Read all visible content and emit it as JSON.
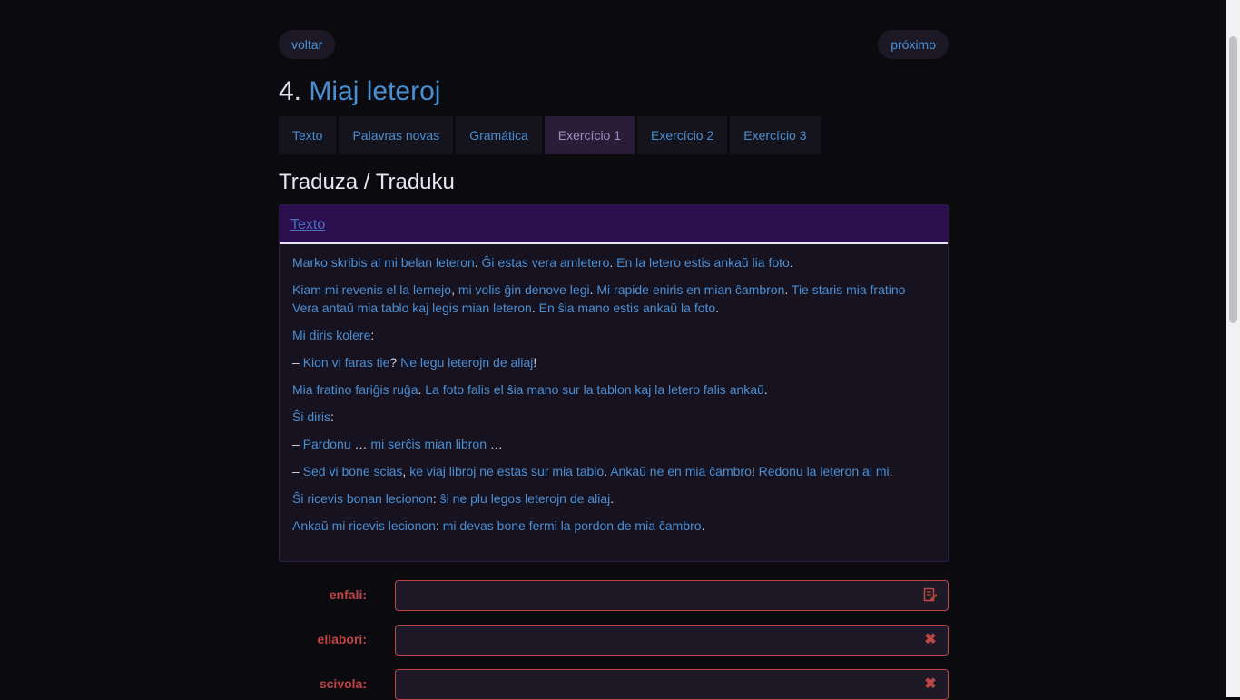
{
  "nav": {
    "back_label": "voltar",
    "next_label": "próximo"
  },
  "lesson": {
    "number": "4.",
    "name": "Miaj leteroj"
  },
  "tabs": [
    {
      "label": "Texto",
      "active": false
    },
    {
      "label": "Palavras novas",
      "active": false
    },
    {
      "label": "Gramática",
      "active": false
    },
    {
      "label": "Exercício 1",
      "active": true
    },
    {
      "label": "Exercício 2",
      "active": false
    },
    {
      "label": "Exercício 3",
      "active": false
    }
  ],
  "section_title": "Traduza / Traduku",
  "panel": {
    "header_link": "Texto",
    "paragraphs": [
      [
        {
          "t": "Marko skribis al mi belan leteron",
          "w": true
        },
        {
          "t": ". ",
          "w": false
        },
        {
          "t": "Ĝi estas vera amletero",
          "w": true
        },
        {
          "t": ". ",
          "w": false
        },
        {
          "t": "En la letero estis ankaŭ lia foto",
          "w": true
        },
        {
          "t": ".",
          "w": false
        }
      ],
      [
        {
          "t": "Kiam mi revenis el la lernejo",
          "w": true
        },
        {
          "t": ", ",
          "w": false
        },
        {
          "t": "mi volis ĝin denove legi",
          "w": true
        },
        {
          "t": ". ",
          "w": false
        },
        {
          "t": "Mi rapide eniris en mian ĉambron",
          "w": true
        },
        {
          "t": ". ",
          "w": false
        },
        {
          "t": "Tie staris mia fratino Vera antaŭ mia tablo kaj legis mian leteron",
          "w": true
        },
        {
          "t": ". ",
          "w": false
        },
        {
          "t": "En ŝia mano estis ankaŭ la foto",
          "w": true
        },
        {
          "t": ".",
          "w": false
        }
      ],
      [
        {
          "t": "Mi diris kolere",
          "w": true
        },
        {
          "t": ":",
          "w": false
        }
      ],
      [
        {
          "t": "– ",
          "w": false
        },
        {
          "t": "Kion vi faras tie",
          "w": true
        },
        {
          "t": "? ",
          "w": false
        },
        {
          "t": "Ne legu leterojn de aliaj",
          "w": true
        },
        {
          "t": "!",
          "w": false
        }
      ],
      [
        {
          "t": "Mia fratino fariĝis ruĝa",
          "w": true
        },
        {
          "t": ". ",
          "w": false
        },
        {
          "t": "La foto falis el ŝia mano sur la tablon kaj la letero falis ankaŭ",
          "w": true
        },
        {
          "t": ".",
          "w": false
        }
      ],
      [
        {
          "t": "Ŝi diris",
          "w": true
        },
        {
          "t": ":",
          "w": false
        }
      ],
      [
        {
          "t": "– ",
          "w": false
        },
        {
          "t": "Pardonu",
          "w": true
        },
        {
          "t": " … ",
          "w": false
        },
        {
          "t": "mi serĉis mian libron",
          "w": true
        },
        {
          "t": " …",
          "w": false
        }
      ],
      [
        {
          "t": "– ",
          "w": false
        },
        {
          "t": "Sed vi bone scias",
          "w": true
        },
        {
          "t": ", ",
          "w": false
        },
        {
          "t": "ke viaj libroj ne estas sur mia tablo",
          "w": true
        },
        {
          "t": ". ",
          "w": false
        },
        {
          "t": "Ankaŭ ne en mia ĉambro",
          "w": true
        },
        {
          "t": "! ",
          "w": false
        },
        {
          "t": "Redonu la leteron al mi",
          "w": true
        },
        {
          "t": ".",
          "w": false
        }
      ],
      [
        {
          "t": "Ŝi ricevis bonan lecionon",
          "w": true
        },
        {
          "t": ": ",
          "w": false
        },
        {
          "t": "ŝi ne plu legos leterojn de aliaj",
          "w": true
        },
        {
          "t": ".",
          "w": false
        }
      ],
      [
        {
          "t": "Ankaŭ mi ricevis lecionon",
          "w": true
        },
        {
          "t": ": ",
          "w": false
        },
        {
          "t": "mi devas bone fermi la pordon de mia ĉambro",
          "w": true
        },
        {
          "t": ".",
          "w": false
        }
      ]
    ]
  },
  "form": [
    {
      "label": "enfali:",
      "value": "",
      "icon": "edit-icon"
    },
    {
      "label": "ellabori:",
      "value": "",
      "icon": "close-icon"
    },
    {
      "label": "scivola:",
      "value": "",
      "icon": "close-icon"
    }
  ],
  "colors": {
    "link": "#4a8fd4",
    "error": "#c04545",
    "panel_header": "#2b0e4e",
    "background": "#0b0a0e"
  }
}
